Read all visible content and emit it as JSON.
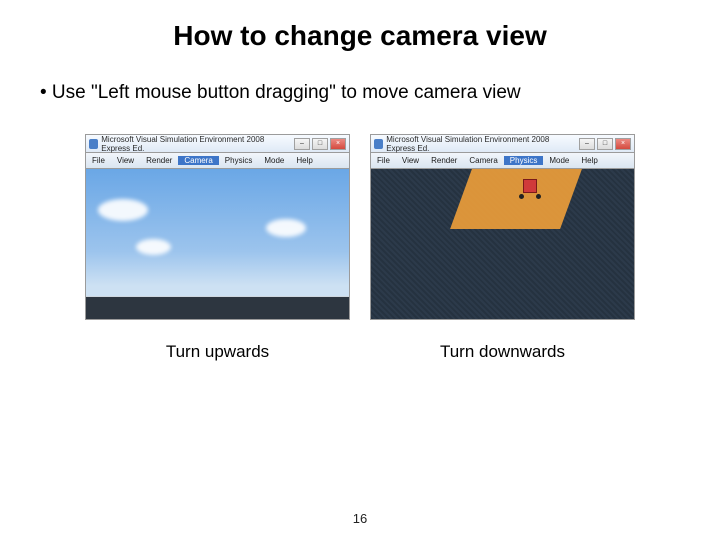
{
  "title": "How to change camera view",
  "bullet": "•   Use \"Left mouse button dragging\" to move camera view",
  "window": {
    "title": "Microsoft Visual Simulation Environment 2008 Express Ed.",
    "menu": [
      "File",
      "View",
      "Render",
      "Camera",
      "Physics",
      "Mode",
      "Help"
    ]
  },
  "left": {
    "selected_menu": "Camera",
    "caption": "Turn upwards"
  },
  "right": {
    "selected_menu": "Physics",
    "caption": "Turn downwards"
  },
  "page_number": "16"
}
